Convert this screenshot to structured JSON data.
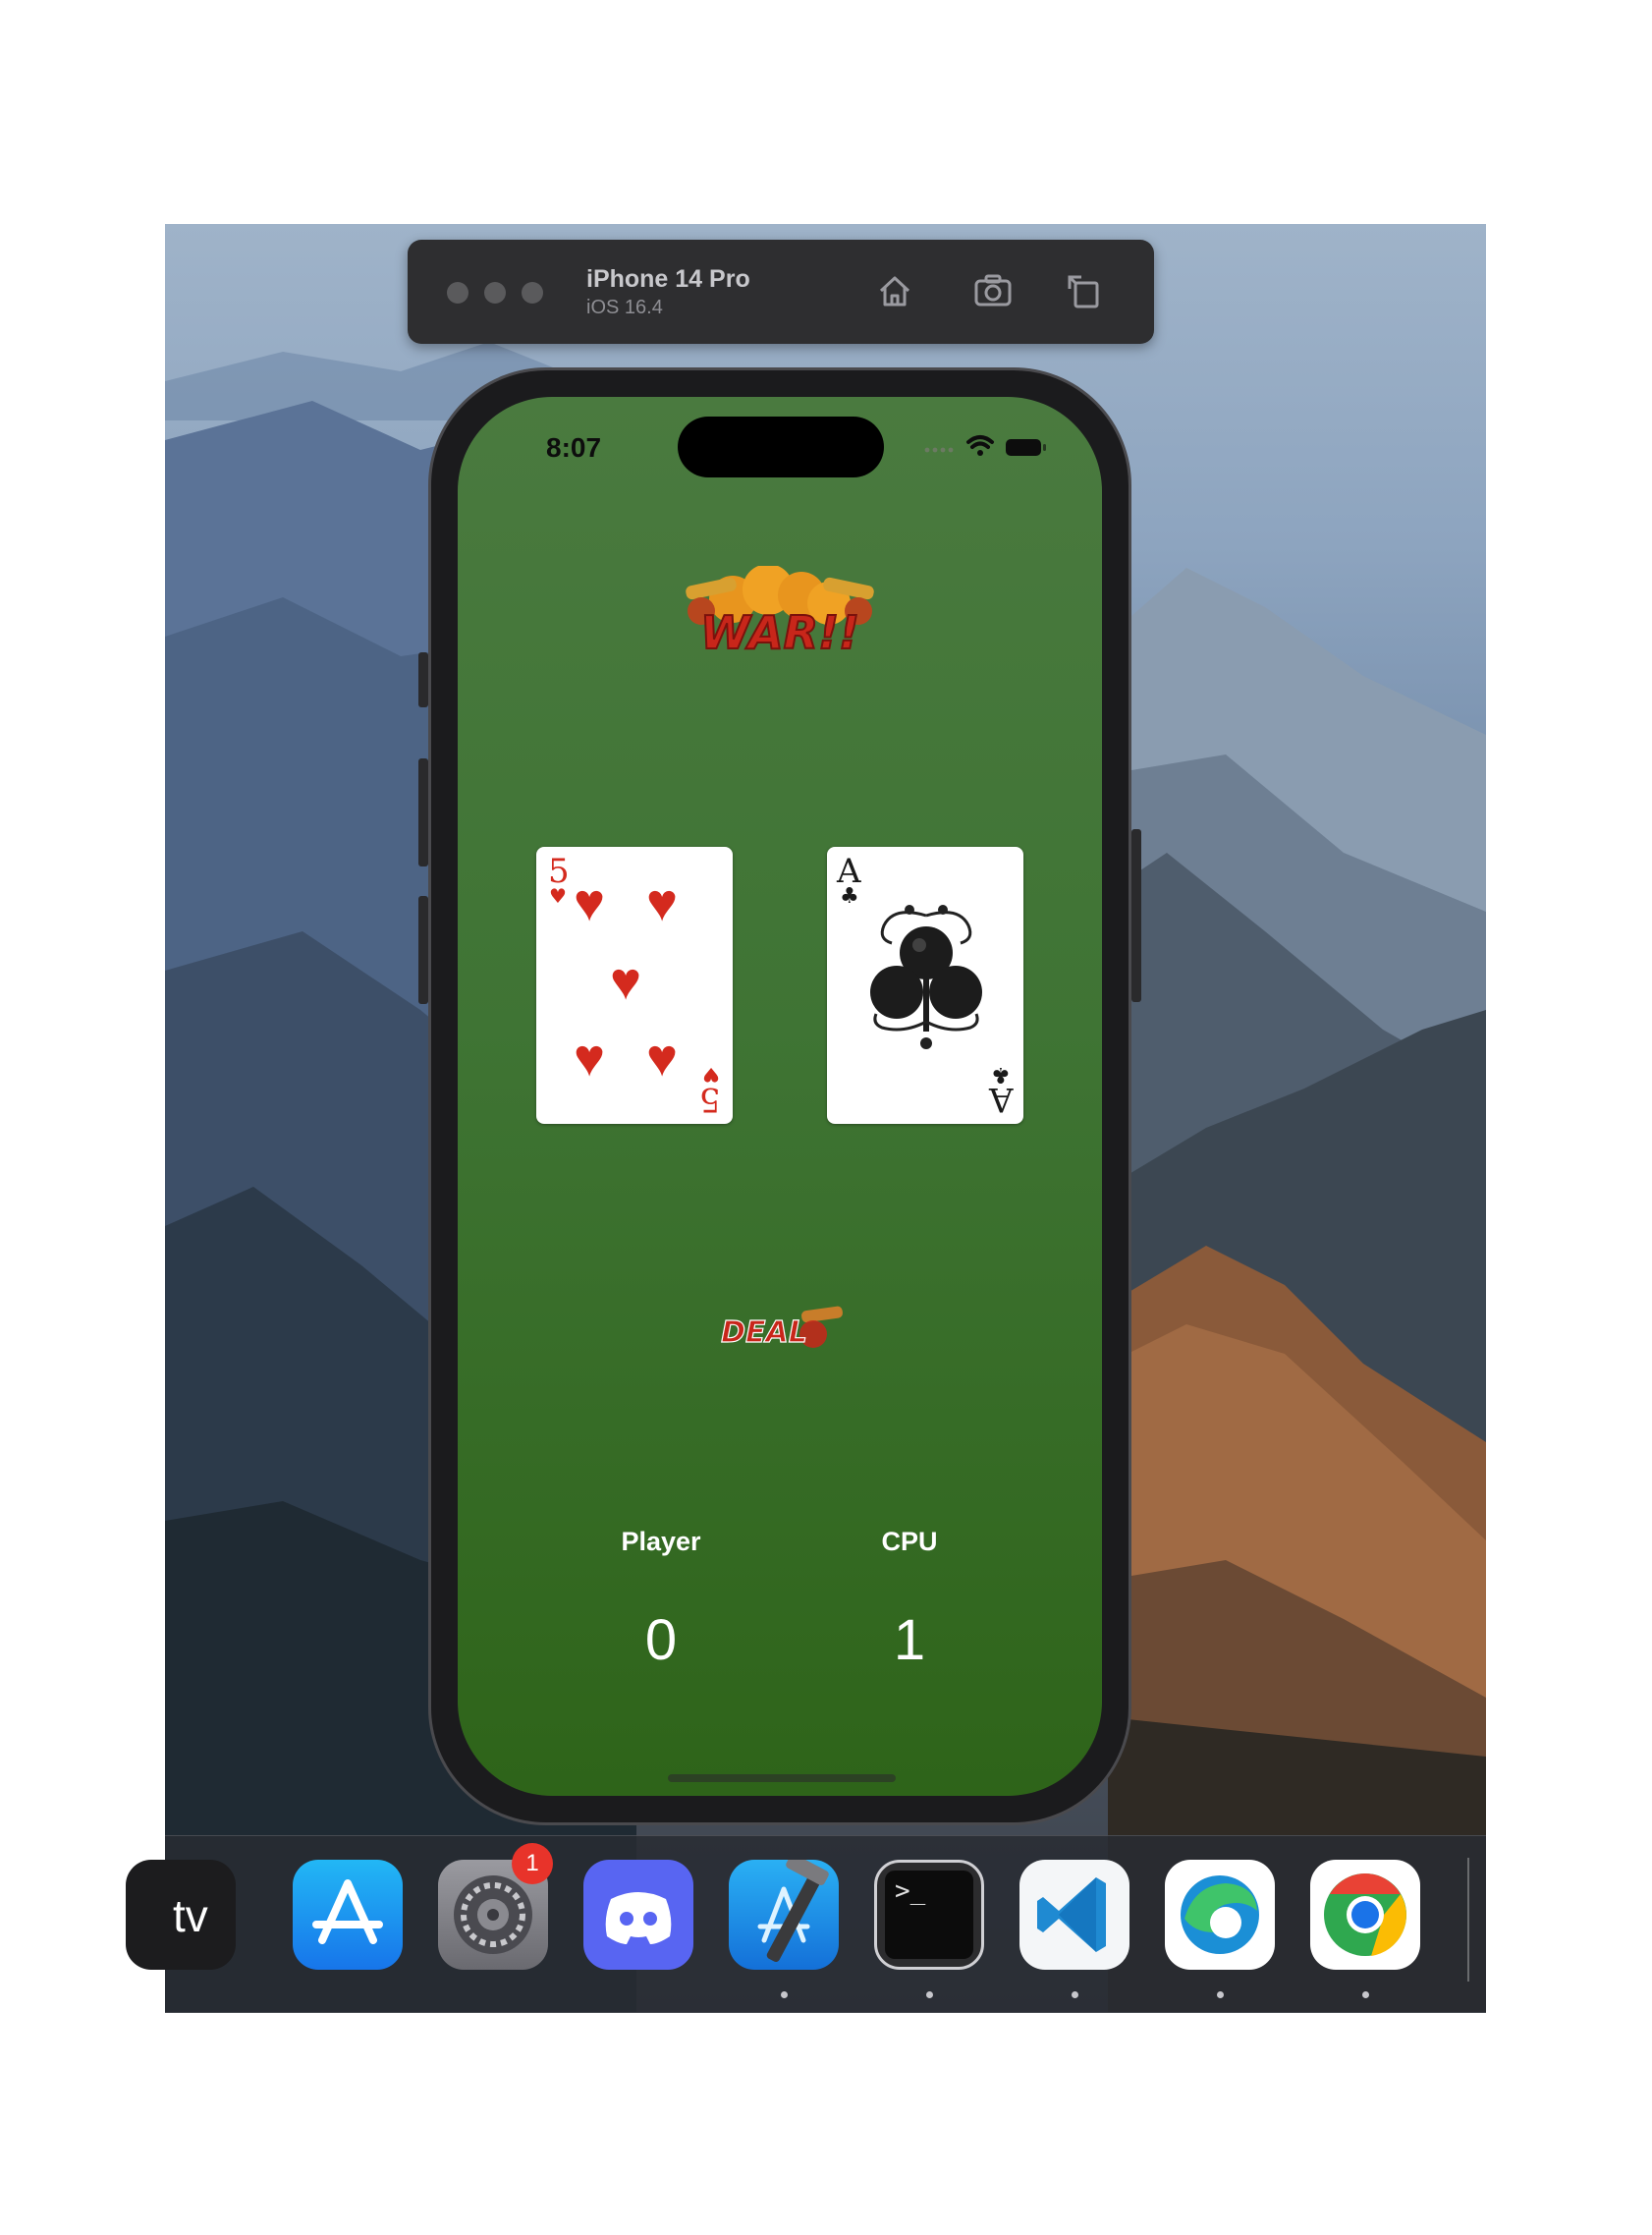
{
  "simulator": {
    "device_name": "iPhone 14 Pro",
    "os_version": "iOS 16.4",
    "home_icon": "home-icon",
    "screenshot_icon": "camera-icon",
    "rotate_icon": "rotate-icon"
  },
  "status_bar": {
    "time": "8:07",
    "icons": [
      "signal-dots-icon",
      "wifi-icon",
      "battery-icon"
    ]
  },
  "game": {
    "logo_text": "WAR!!",
    "player_card": {
      "rank": "5",
      "suit": "hearts",
      "suit_glyph": "♥"
    },
    "cpu_card": {
      "rank": "A",
      "suit": "clubs",
      "suit_glyph": "♣"
    },
    "deal_button": "DEAL",
    "player_label": "Player",
    "cpu_label": "CPU",
    "player_score": "0",
    "cpu_score": "1"
  },
  "dock": {
    "apps": [
      {
        "name": "Apple TV",
        "label": "tv"
      },
      {
        "name": "App Store"
      },
      {
        "name": "System Settings",
        "badge": "1"
      },
      {
        "name": "Discord"
      },
      {
        "name": "Xcode"
      },
      {
        "name": "Terminal",
        "label": ">_"
      },
      {
        "name": "Visual Studio Code"
      },
      {
        "name": "Microsoft Edge"
      },
      {
        "name": "Google Chrome"
      }
    ]
  },
  "colors": {
    "felt_top": "#4a7a3f",
    "felt_bottom": "#2e6419",
    "heart_red": "#d42a1e",
    "badge_red": "#e8332a"
  }
}
